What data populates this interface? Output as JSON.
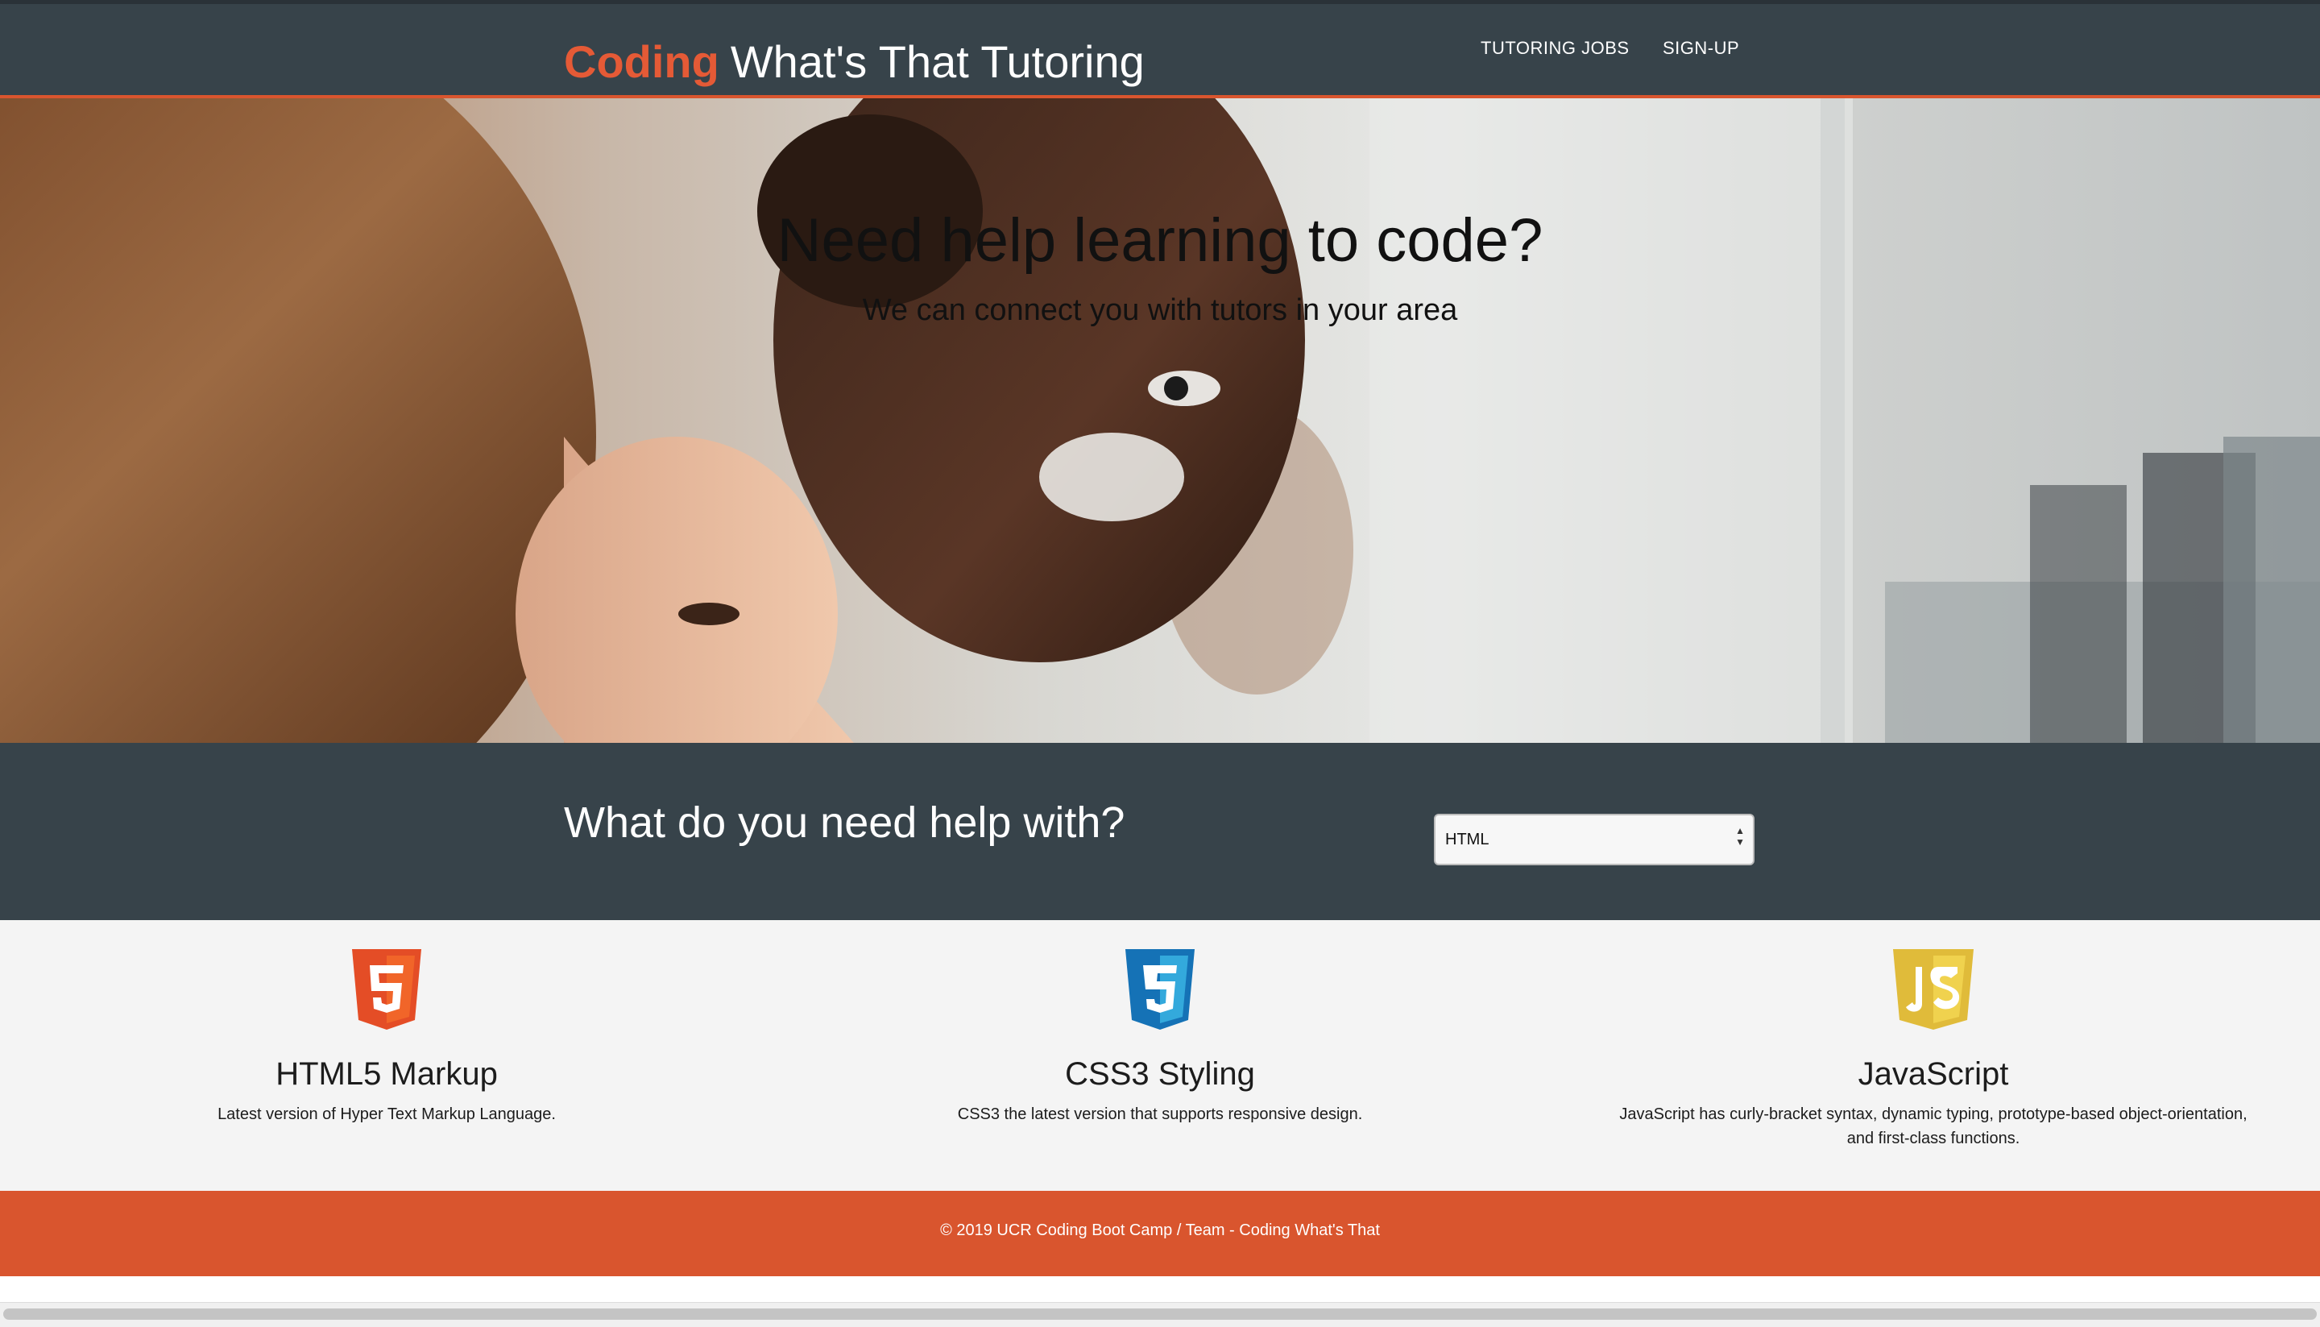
{
  "navbar": {
    "brand_accent": "Coding",
    "brand_rest": "What's That Tutoring",
    "links": [
      {
        "label": "TUTORING JOBS"
      },
      {
        "label": "SIGN-UP"
      }
    ]
  },
  "hero": {
    "title": "Need help learning to code?",
    "subtitle": "We can connect you with tutors in your area"
  },
  "help": {
    "title": "What do you need help with?",
    "select_value": "HTML"
  },
  "features": [
    {
      "icon": "html5-icon",
      "title": "HTML5 Markup",
      "desc": "Latest version of Hyper Text Markup Language."
    },
    {
      "icon": "css3-icon",
      "title": "CSS3 Styling",
      "desc": "CSS3 the latest version that supports responsive design."
    },
    {
      "icon": "javascript-icon",
      "title": "JavaScript",
      "desc": "JavaScript has curly-bracket syntax, dynamic typing, prototype-based object-orientation, and first-class functions."
    }
  ],
  "footer": {
    "text": "© 2019 UCR Coding Boot Camp / Team - Coding What's That"
  },
  "colors": {
    "navbar_bg": "#37434a",
    "accent": "#d9552e",
    "features_bg": "#f4f4f4",
    "html5": "#e44d26",
    "css3": "#1572b6",
    "javascript": "#e0bb3a"
  }
}
